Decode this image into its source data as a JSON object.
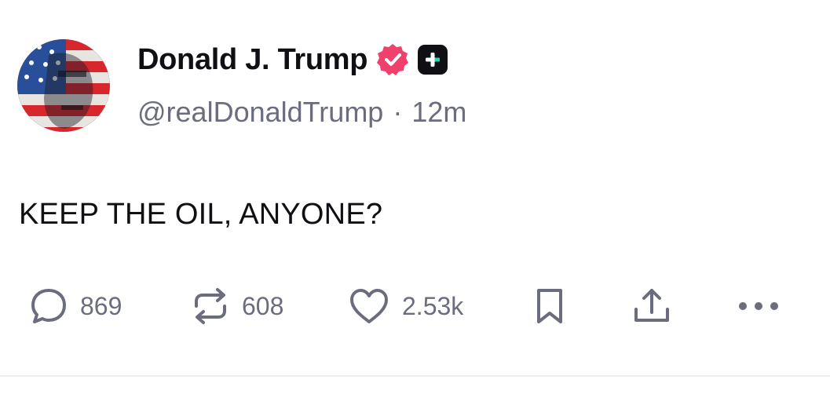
{
  "post": {
    "author_name": "Donald J. Trump",
    "handle": "@realDonaldTrump",
    "separator": "·",
    "time_ago": "12m",
    "text": "KEEP THE OIL, ANYONE?"
  },
  "actions": {
    "replies": "869",
    "reposts": "608",
    "likes": "2.53k"
  },
  "icons": [
    "avatar",
    "verified-badge-icon",
    "plus-badge-icon",
    "reply-icon",
    "repost-icon",
    "like-icon",
    "bookmark-icon",
    "share-icon",
    "more-icon"
  ],
  "colors": {
    "verified": "#f0406c",
    "text": "#0f0f14",
    "muted": "#6b6c7d"
  }
}
